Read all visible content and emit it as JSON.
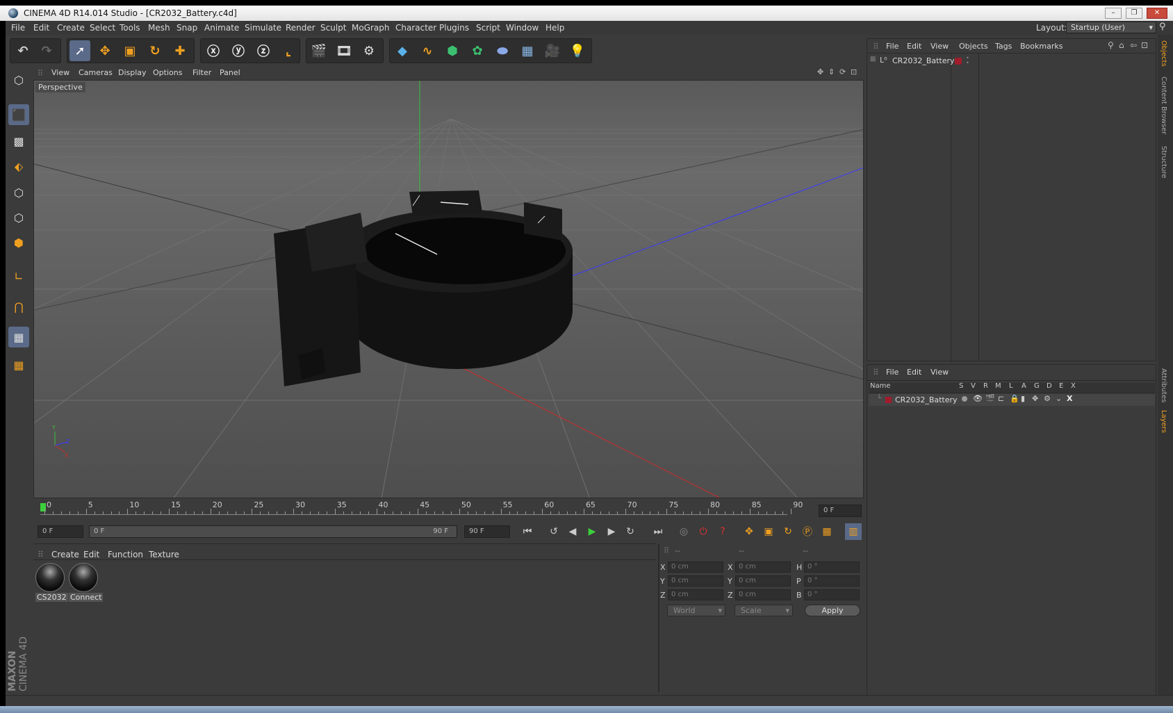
{
  "window": {
    "title": "CINEMA 4D R14.014 Studio - [CR2032_Battery.c4d]",
    "layout_label": "Layout:",
    "layout_value": "Startup (User)"
  },
  "menubar": [
    "File",
    "Edit",
    "Create",
    "Select",
    "Tools",
    "Mesh",
    "Snap",
    "Animate",
    "Simulate",
    "Render",
    "Sculpt",
    "MoGraph",
    "Character",
    "Plugins",
    "Script",
    "Window",
    "Help"
  ],
  "viewport": {
    "menu": [
      "View",
      "Cameras",
      "Display",
      "Options",
      "Filter",
      "Panel"
    ],
    "label": "Perspective"
  },
  "timeline": {
    "ticks": [
      "0",
      "5",
      "10",
      "15",
      "20",
      "25",
      "30",
      "35",
      "40",
      "45",
      "50",
      "55",
      "60",
      "65",
      "70",
      "75",
      "80",
      "85",
      "90"
    ],
    "current_frame": "0 F",
    "start_field": "0 F",
    "range_start": "0 F",
    "range_end": "90 F",
    "end_field": "90 F"
  },
  "material_panel": {
    "menu": [
      "Create",
      "Edit",
      "Function",
      "Texture"
    ],
    "materials": [
      "CS2032",
      "Connect"
    ]
  },
  "coords": {
    "headers": [
      "--",
      "--",
      "--"
    ],
    "rows": [
      {
        "a": "X",
        "av": "0 cm",
        "b": "X",
        "bv": "0 cm",
        "c": "H",
        "cv": "0 °"
      },
      {
        "a": "Y",
        "av": "0 cm",
        "b": "Y",
        "bv": "0 cm",
        "c": "P",
        "cv": "0 °"
      },
      {
        "a": "Z",
        "av": "0 cm",
        "b": "Z",
        "bv": "0 cm",
        "c": "B",
        "cv": "0 °"
      }
    ],
    "mode": "World",
    "scale": "Scale",
    "apply": "Apply"
  },
  "objects_panel": {
    "menu": [
      "File",
      "Edit",
      "View",
      "Objects",
      "Tags",
      "Bookmarks"
    ],
    "items": [
      {
        "name": "CR2032_Battery"
      }
    ]
  },
  "layers_panel": {
    "menu": [
      "File",
      "Edit",
      "View"
    ],
    "columns": [
      "Name",
      "S",
      "V",
      "R",
      "M",
      "L",
      "A",
      "G",
      "D",
      "E",
      "X"
    ],
    "items": [
      {
        "name": "CR2032_Battery"
      }
    ]
  },
  "side_tabs": [
    "Objects",
    "Content Browser",
    "Structure",
    "Attributes",
    "Layers"
  ],
  "brand": {
    "maxon": "MAXON",
    "product": "CINEMA 4D"
  },
  "colors": {
    "accent": "#f0a020",
    "bg": "#3b3b3b",
    "dark": "#2a2a2a",
    "layer_red": "#a01c2c"
  }
}
